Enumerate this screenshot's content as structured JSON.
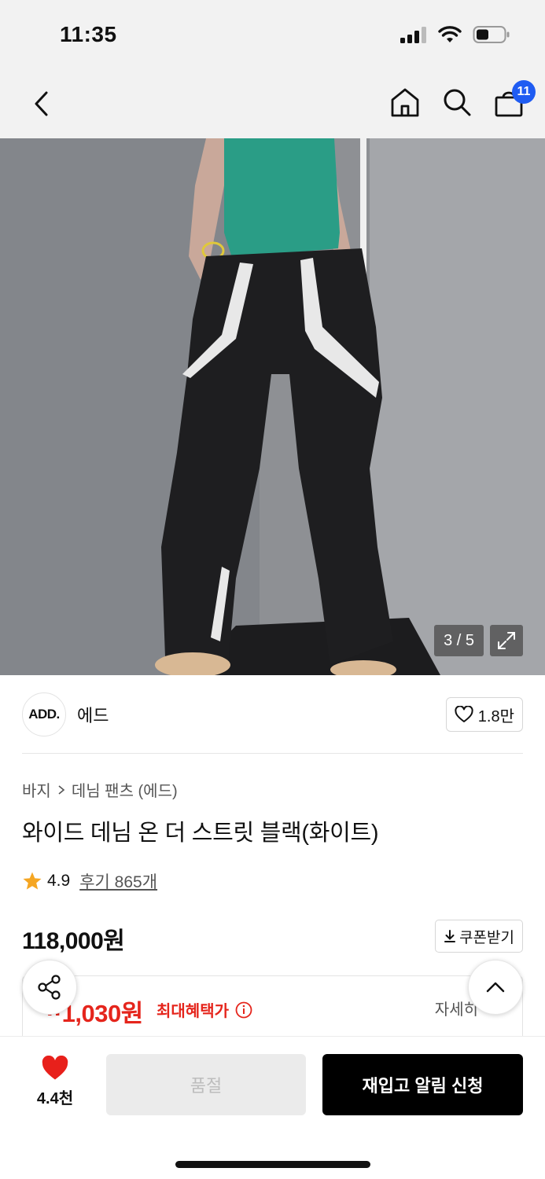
{
  "status": {
    "time": "11:35"
  },
  "nav": {
    "cart_count": "11"
  },
  "image": {
    "counter": "3 / 5"
  },
  "brand": {
    "logo": "ADD.",
    "name": "에드",
    "likes": "1.8만"
  },
  "breadcrumb": {
    "category": "바지",
    "sub": "데님 팬츠 (에드)"
  },
  "product": {
    "title": "와이드 데님 온 더 스트릿 블랙(화이트)",
    "rating": "4.9",
    "review_text": "후기 865개",
    "price": "118,000원",
    "coupon_label": "쿠폰받기",
    "benefit_price": "··1,030원",
    "benefit_label": "최대혜택가",
    "benefit_detail": "자세히"
  },
  "bottom": {
    "wish_count": "4.4천",
    "soldout_label": "품절",
    "restock_label": "재입고 알림 신청"
  },
  "colors": {
    "accent_blue": "#1f5cf2",
    "benefit_red": "#e5251c",
    "heart_red": "#e8201b",
    "star": "#f5a623"
  }
}
